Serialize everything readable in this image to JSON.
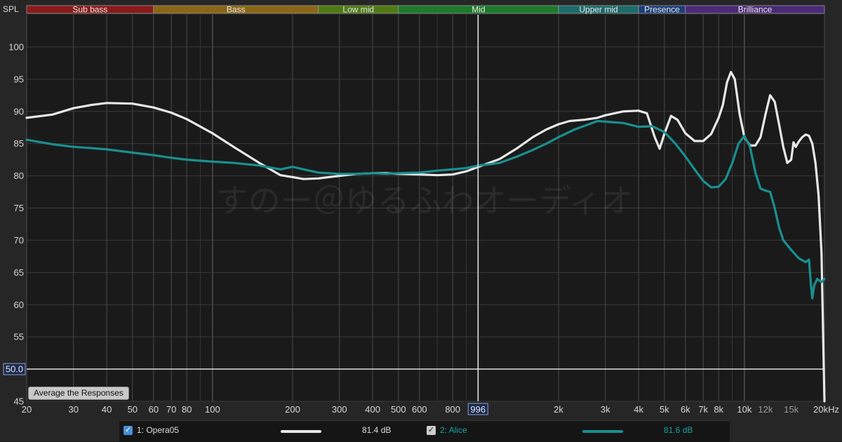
{
  "bands": [
    {
      "name": "Sub bass",
      "from": 20,
      "to": 60,
      "color": "#8b1a1a"
    },
    {
      "name": "Bass",
      "from": 60,
      "to": 250,
      "color": "#8a6614"
    },
    {
      "name": "Low mid",
      "from": 250,
      "to": 500,
      "color": "#4f7a12"
    },
    {
      "name": "Mid",
      "from": 500,
      "to": 2000,
      "color": "#1c7a2a"
    },
    {
      "name": "Upper mid",
      "from": 2000,
      "to": 4000,
      "color": "#1d6b6b"
    },
    {
      "name": "Presence",
      "from": 4000,
      "to": 6000,
      "color": "#1c3f7a"
    },
    {
      "name": "Brilliance",
      "from": 6000,
      "to": 20000,
      "color": "#4b2a78"
    }
  ],
  "watermark": "すのー＠ゆるふわオーディオ",
  "buttons": {
    "average": "Average the Responses"
  },
  "cursor": {
    "freq_label": "996",
    "spl_label": "50.0"
  },
  "legend": [
    {
      "index_label": "1: Opera05",
      "level": "81.4 dB",
      "color": "#e8e8e8"
    },
    {
      "index_label": "2: Alice",
      "level": "81.6 dB",
      "color": "#1a8f8f"
    }
  ],
  "chart_data": {
    "type": "line",
    "xscale": "log",
    "xlim": [
      20,
      20000
    ],
    "ylim": [
      45,
      105
    ],
    "ylabel": "SPL",
    "yticks": [
      45,
      50,
      55,
      60,
      65,
      70,
      75,
      80,
      85,
      90,
      95,
      100
    ],
    "xticks": [
      {
        "v": 20,
        "l": "20"
      },
      {
        "v": 30,
        "l": "30"
      },
      {
        "v": 40,
        "l": "40"
      },
      {
        "v": 50,
        "l": "50"
      },
      {
        "v": 60,
        "l": "60"
      },
      {
        "v": 70,
        "l": "70"
      },
      {
        "v": 80,
        "l": "80"
      },
      {
        "v": 100,
        "l": "100"
      },
      {
        "v": 200,
        "l": "200"
      },
      {
        "v": 300,
        "l": "300"
      },
      {
        "v": 400,
        "l": "400"
      },
      {
        "v": 500,
        "l": "500"
      },
      {
        "v": 600,
        "l": "600"
      },
      {
        "v": 800,
        "l": "800"
      },
      {
        "v": 2000,
        "l": "2k"
      },
      {
        "v": 3000,
        "l": "3k"
      },
      {
        "v": 4000,
        "l": "4k"
      },
      {
        "v": 5000,
        "l": "5k"
      },
      {
        "v": 6000,
        "l": "6k"
      },
      {
        "v": 7000,
        "l": "7k"
      },
      {
        "v": 8000,
        "l": "8k"
      },
      {
        "v": 10000,
        "l": "10k"
      },
      {
        "v": 12000,
        "l": "12k"
      },
      {
        "v": 15000,
        "l": "15k"
      },
      {
        "v": 20000,
        "l": "20kHz"
      }
    ],
    "cursor": {
      "x": 996,
      "y": 50
    },
    "series": [
      {
        "name": "1: Opera05",
        "color": "#e8e8e8",
        "points": [
          [
            20,
            89.0
          ],
          [
            25,
            89.5
          ],
          [
            30,
            90.5
          ],
          [
            35,
            91.0
          ],
          [
            40,
            91.3
          ],
          [
            50,
            91.2
          ],
          [
            60,
            90.6
          ],
          [
            70,
            89.8
          ],
          [
            80,
            88.8
          ],
          [
            100,
            86.6
          ],
          [
            120,
            84.5
          ],
          [
            150,
            82.0
          ],
          [
            180,
            80.1
          ],
          [
            200,
            79.8
          ],
          [
            220,
            79.5
          ],
          [
            250,
            79.6
          ],
          [
            300,
            80.0
          ],
          [
            350,
            80.3
          ],
          [
            400,
            80.4
          ],
          [
            450,
            80.4
          ],
          [
            500,
            80.3
          ],
          [
            600,
            80.2
          ],
          [
            700,
            80.1
          ],
          [
            800,
            80.2
          ],
          [
            900,
            80.7
          ],
          [
            1000,
            81.4
          ],
          [
            1200,
            82.6
          ],
          [
            1400,
            84.3
          ],
          [
            1600,
            86.0
          ],
          [
            1800,
            87.2
          ],
          [
            2000,
            88.0
          ],
          [
            2200,
            88.5
          ],
          [
            2500,
            88.7
          ],
          [
            2800,
            89.0
          ],
          [
            3000,
            89.4
          ],
          [
            3500,
            90.0
          ],
          [
            4000,
            90.1
          ],
          [
            4300,
            89.7
          ],
          [
            4600,
            86.0
          ],
          [
            4800,
            84.2
          ],
          [
            5000,
            86.5
          ],
          [
            5300,
            89.3
          ],
          [
            5600,
            88.7
          ],
          [
            6000,
            86.6
          ],
          [
            6500,
            85.4
          ],
          [
            7000,
            85.4
          ],
          [
            7500,
            86.5
          ],
          [
            8000,
            89.0
          ],
          [
            8300,
            91.0
          ],
          [
            8600,
            94.5
          ],
          [
            8900,
            96.1
          ],
          [
            9200,
            95.0
          ],
          [
            9600,
            89.5
          ],
          [
            10000,
            86.0
          ],
          [
            10500,
            84.7
          ],
          [
            11000,
            84.7
          ],
          [
            11500,
            86.0
          ],
          [
            12000,
            89.5
          ],
          [
            12500,
            92.5
          ],
          [
            13000,
            91.5
          ],
          [
            13500,
            88.0
          ],
          [
            14000,
            84.5
          ],
          [
            14500,
            82.0
          ],
          [
            15000,
            82.5
          ],
          [
            15300,
            85.2
          ],
          [
            15600,
            84.5
          ],
          [
            16000,
            85.3
          ],
          [
            16500,
            86.0
          ],
          [
            17000,
            86.4
          ],
          [
            17500,
            86.2
          ],
          [
            18000,
            85.0
          ],
          [
            18500,
            82.0
          ],
          [
            19000,
            77.0
          ],
          [
            19500,
            68.0
          ],
          [
            20000,
            45.0
          ]
        ]
      },
      {
        "name": "2: Alice",
        "color": "#1a8f8f",
        "points": [
          [
            20,
            85.6
          ],
          [
            25,
            84.9
          ],
          [
            30,
            84.5
          ],
          [
            35,
            84.3
          ],
          [
            40,
            84.1
          ],
          [
            50,
            83.6
          ],
          [
            60,
            83.2
          ],
          [
            70,
            82.8
          ],
          [
            80,
            82.5
          ],
          [
            100,
            82.2
          ],
          [
            120,
            82.0
          ],
          [
            150,
            81.6
          ],
          [
            180,
            81.0
          ],
          [
            200,
            81.4
          ],
          [
            220,
            81.0
          ],
          [
            250,
            80.5
          ],
          [
            300,
            80.3
          ],
          [
            350,
            80.3
          ],
          [
            400,
            80.4
          ],
          [
            450,
            80.3
          ],
          [
            500,
            80.4
          ],
          [
            600,
            80.5
          ],
          [
            700,
            80.8
          ],
          [
            800,
            81.0
          ],
          [
            900,
            81.2
          ],
          [
            1000,
            81.6
          ],
          [
            1100,
            81.8
          ],
          [
            1200,
            82.0
          ],
          [
            1400,
            83.0
          ],
          [
            1600,
            84.0
          ],
          [
            1800,
            85.0
          ],
          [
            2000,
            86.0
          ],
          [
            2300,
            87.2
          ],
          [
            2600,
            88.0
          ],
          [
            2800,
            88.5
          ],
          [
            3000,
            88.4
          ],
          [
            3500,
            88.2
          ],
          [
            4000,
            87.6
          ],
          [
            4500,
            87.7
          ],
          [
            5000,
            86.8
          ],
          [
            5500,
            85.0
          ],
          [
            6000,
            83.0
          ],
          [
            6500,
            81.0
          ],
          [
            7000,
            79.2
          ],
          [
            7500,
            78.2
          ],
          [
            8000,
            78.3
          ],
          [
            8500,
            79.5
          ],
          [
            9000,
            82.0
          ],
          [
            9500,
            85.0
          ],
          [
            10000,
            86.2
          ],
          [
            10500,
            84.5
          ],
          [
            11000,
            80.5
          ],
          [
            11500,
            78.0
          ],
          [
            12000,
            77.7
          ],
          [
            12500,
            77.5
          ],
          [
            13000,
            75.0
          ],
          [
            13500,
            72.0
          ],
          [
            14000,
            70.0
          ],
          [
            15000,
            68.5
          ],
          [
            16000,
            67.2
          ],
          [
            17000,
            66.6
          ],
          [
            17500,
            67.0
          ],
          [
            17800,
            63.0
          ],
          [
            18000,
            61.0
          ],
          [
            18300,
            63.0
          ],
          [
            18800,
            64.0
          ],
          [
            19500,
            63.5
          ],
          [
            20000,
            64.0
          ]
        ]
      }
    ]
  }
}
